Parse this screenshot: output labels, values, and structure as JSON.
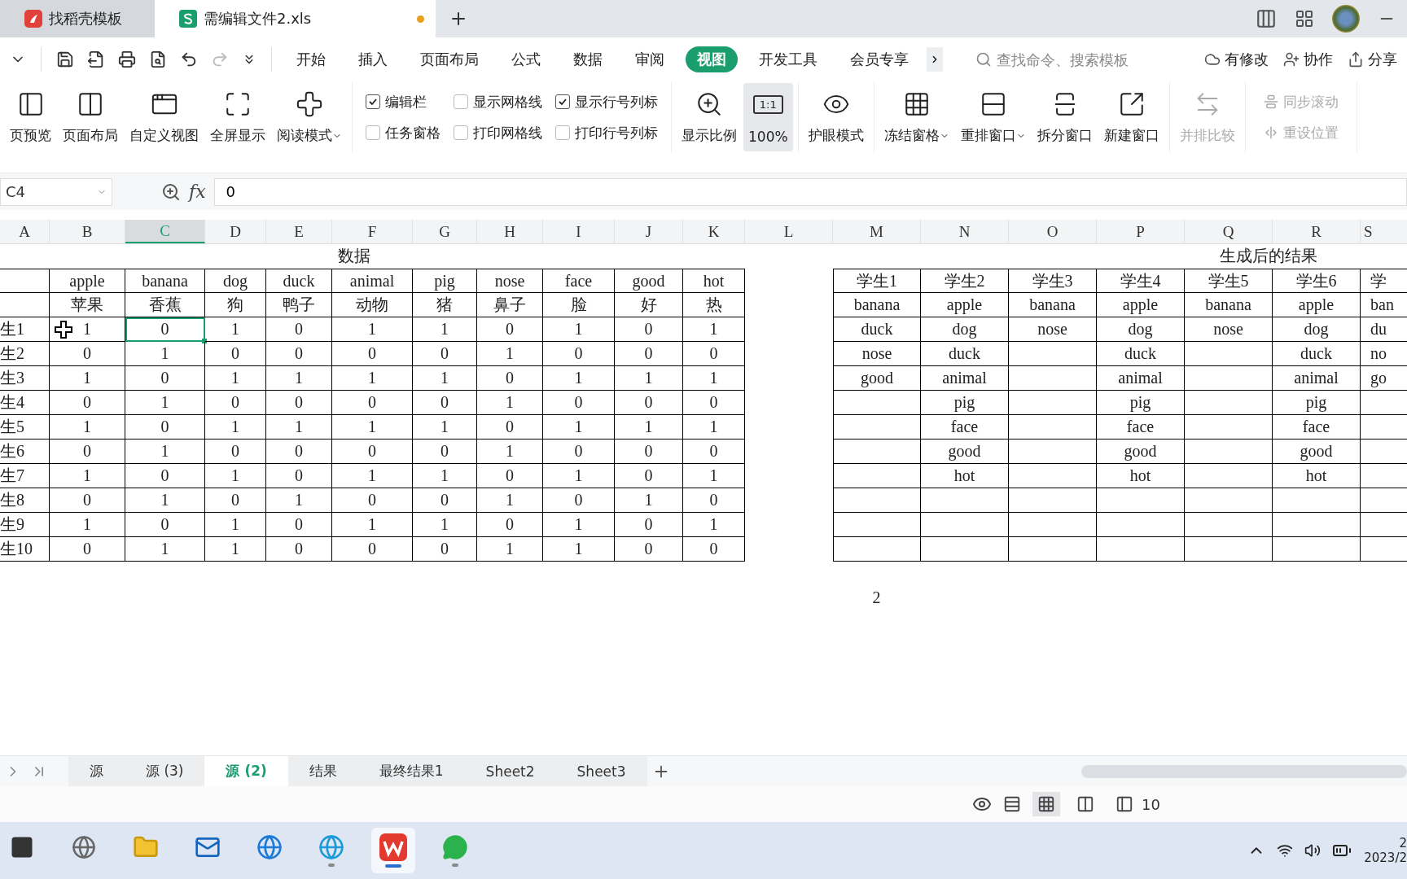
{
  "window_tabs": [
    {
      "label": "找稻壳模板",
      "selected": false,
      "unsaved": false
    },
    {
      "label": "需编辑文件2.xls",
      "selected": true,
      "unsaved": true
    }
  ],
  "menu": [
    {
      "label": "开始",
      "selected": false
    },
    {
      "label": "插入",
      "selected": false
    },
    {
      "label": "页面布局",
      "selected": false
    },
    {
      "label": "公式",
      "selected": false
    },
    {
      "label": "数据",
      "selected": false
    },
    {
      "label": "审阅",
      "selected": false
    },
    {
      "label": "视图",
      "selected": true
    },
    {
      "label": "开发工具",
      "selected": false
    },
    {
      "label": "会员专享",
      "selected": false
    }
  ],
  "search": {
    "placeholder": "查找命令、搜索模板"
  },
  "actions": [
    "有修改",
    "协作",
    "分享"
  ],
  "toolbar": {
    "groups": [
      {
        "kind": "big",
        "items": [
          {
            "label": "页预览",
            "has_menu": false,
            "pressed": false,
            "disabled": false
          },
          {
            "label": "页面布局",
            "has_menu": false,
            "pressed": false,
            "disabled": false
          },
          {
            "label": "自定义视图",
            "has_menu": false,
            "pressed": false,
            "disabled": false
          },
          {
            "label": "全屏显示",
            "has_menu": false,
            "pressed": false,
            "disabled": false
          },
          {
            "label": "阅读模式",
            "has_menu": true,
            "pressed": false,
            "disabled": false
          }
        ]
      },
      {
        "kind": "checks",
        "items": [
          {
            "label": "编辑栏",
            "checked": true
          },
          {
            "label": "任务窗格",
            "checked": false
          },
          {
            "label": "显示网格线",
            "checked": false
          },
          {
            "label": "打印网格线",
            "checked": false
          },
          {
            "label": "显示行号列标",
            "checked": true
          },
          {
            "label": "打印行号列标",
            "checked": false
          }
        ]
      },
      {
        "kind": "big",
        "items": [
          {
            "label": "显示比例",
            "has_menu": false,
            "pressed": false,
            "disabled": false
          },
          {
            "label": "100%",
            "badge": "1:1",
            "has_menu": false,
            "pressed": true,
            "disabled": false
          }
        ]
      },
      {
        "kind": "big",
        "items": [
          {
            "label": "护眼模式",
            "has_menu": false,
            "pressed": false,
            "disabled": false
          }
        ]
      },
      {
        "kind": "big",
        "items": [
          {
            "label": "冻结窗格",
            "has_menu": true,
            "pressed": false,
            "disabled": false
          },
          {
            "label": "重排窗口",
            "has_menu": true,
            "pressed": false,
            "disabled": false
          },
          {
            "label": "拆分窗口",
            "has_menu": false,
            "pressed": false,
            "disabled": false
          },
          {
            "label": "新建窗口",
            "has_menu": false,
            "pressed": false,
            "disabled": false
          }
        ]
      },
      {
        "kind": "big",
        "items": [
          {
            "label": "并排比较",
            "has_menu": false,
            "pressed": false,
            "disabled": true
          }
        ]
      },
      {
        "kind": "small",
        "items": [
          {
            "label": "同步滚动",
            "disabled": true
          },
          {
            "label": "重设位置",
            "disabled": true
          }
        ]
      }
    ]
  },
  "formula_bar": {
    "cell": "C4",
    "fx": "fx",
    "value": "0"
  },
  "columns": [
    {
      "letter": "A",
      "selected": false
    },
    {
      "letter": "B",
      "selected": false
    },
    {
      "letter": "C",
      "selected": true
    },
    {
      "letter": "D",
      "selected": false
    },
    {
      "letter": "E",
      "selected": false
    },
    {
      "letter": "F",
      "selected": false
    },
    {
      "letter": "G",
      "selected": false
    },
    {
      "letter": "H",
      "selected": false
    },
    {
      "letter": "I",
      "selected": false
    },
    {
      "letter": "J",
      "selected": false
    },
    {
      "letter": "K",
      "selected": false
    },
    {
      "letter": "L",
      "selected": false
    },
    {
      "letter": "M",
      "selected": false
    },
    {
      "letter": "N",
      "selected": false
    },
    {
      "letter": "O",
      "selected": false
    },
    {
      "letter": "P",
      "selected": false
    },
    {
      "letter": "Q",
      "selected": false
    },
    {
      "letter": "R",
      "selected": false
    },
    {
      "letter": "S",
      "selected": false
    }
  ],
  "data_table": {
    "title": "数据",
    "headers_en": [
      "apple",
      "banana",
      "dog",
      "duck",
      "animal",
      "pig",
      "nose",
      "face",
      "good",
      "hot"
    ],
    "headers_cn": [
      "苹果",
      "香蕉",
      "狗",
      "鸭子",
      "动物",
      "猪",
      "鼻子",
      "脸",
      "好",
      "热"
    ],
    "rows": [
      {
        "label": "生1",
        "selected": true,
        "values": [
          "1",
          "0",
          "1",
          "0",
          "1",
          "1",
          "0",
          "1",
          "0",
          "1"
        ]
      },
      {
        "label": "生2",
        "selected": false,
        "values": [
          "0",
          "1",
          "0",
          "0",
          "0",
          "0",
          "1",
          "0",
          "0",
          "0"
        ]
      },
      {
        "label": "生3",
        "selected": false,
        "values": [
          "1",
          "0",
          "1",
          "1",
          "1",
          "1",
          "0",
          "1",
          "1",
          "1"
        ]
      },
      {
        "label": "生4",
        "selected": false,
        "values": [
          "0",
          "1",
          "0",
          "0",
          "0",
          "0",
          "1",
          "0",
          "0",
          "0"
        ]
      },
      {
        "label": "生5",
        "selected": false,
        "values": [
          "1",
          "0",
          "1",
          "1",
          "1",
          "1",
          "0",
          "1",
          "1",
          "1"
        ]
      },
      {
        "label": "生6",
        "selected": false,
        "values": [
          "0",
          "1",
          "0",
          "0",
          "0",
          "0",
          "1",
          "0",
          "0",
          "0"
        ]
      },
      {
        "label": "生7",
        "selected": false,
        "values": [
          "1",
          "0",
          "1",
          "0",
          "1",
          "1",
          "0",
          "1",
          "0",
          "1"
        ]
      },
      {
        "label": "生8",
        "selected": false,
        "values": [
          "0",
          "1",
          "0",
          "1",
          "0",
          "0",
          "1",
          "0",
          "1",
          "0"
        ]
      },
      {
        "label": "生9",
        "selected": false,
        "values": [
          "1",
          "0",
          "1",
          "0",
          "1",
          "1",
          "0",
          "1",
          "0",
          "1"
        ]
      },
      {
        "label": "生10",
        "selected": false,
        "values": [
          "0",
          "1",
          "1",
          "0",
          "0",
          "0",
          "1",
          "1",
          "0",
          "0"
        ]
      }
    ]
  },
  "result_table": {
    "title": "生成后的结果",
    "columns": [
      {
        "header": "学生1",
        "words": [
          "banana",
          "duck",
          "nose",
          "good"
        ]
      },
      {
        "header": "学生2",
        "words": [
          "apple",
          "dog",
          "duck",
          "animal",
          "pig",
          "face",
          "good",
          "hot"
        ]
      },
      {
        "header": "学生3",
        "words": [
          "banana",
          "nose"
        ]
      },
      {
        "header": "学生4",
        "words": [
          "apple",
          "dog",
          "duck",
          "animal",
          "pig",
          "face",
          "good",
          "hot"
        ]
      },
      {
        "header": "学生5",
        "words": [
          "banana",
          "nose"
        ]
      },
      {
        "header": "学生6",
        "words": [
          "apple",
          "dog",
          "duck",
          "animal",
          "pig",
          "face",
          "good",
          "hot"
        ]
      },
      {
        "header": "学",
        "words": [
          "ban",
          "du",
          "no",
          "go"
        ]
      }
    ]
  },
  "note": "2",
  "sheet_tabs": [
    {
      "label": "源",
      "selected": false
    },
    {
      "label": "源 (3)",
      "selected": false
    },
    {
      "label": "源 (2)",
      "selected": true
    },
    {
      "label": "结果",
      "selected": false
    },
    {
      "label": "最终结果1",
      "selected": false
    },
    {
      "label": "Sheet2",
      "selected": false
    },
    {
      "label": "Sheet3",
      "selected": false
    }
  ],
  "status_bar": {
    "zoom": "10",
    "views": [
      {
        "selected": true
      },
      {
        "selected": false
      },
      {
        "selected": false
      }
    ]
  },
  "taskbar": {
    "apps": [
      {
        "running": false,
        "active": false
      },
      {
        "running": false,
        "active": false
      },
      {
        "running": false,
        "active": false
      },
      {
        "running": false,
        "active": false
      },
      {
        "running": false,
        "active": false
      },
      {
        "running": true,
        "active": false
      },
      {
        "running": true,
        "active": true
      },
      {
        "running": true,
        "active": false
      }
    ],
    "time": "2",
    "date": "2023/2"
  }
}
